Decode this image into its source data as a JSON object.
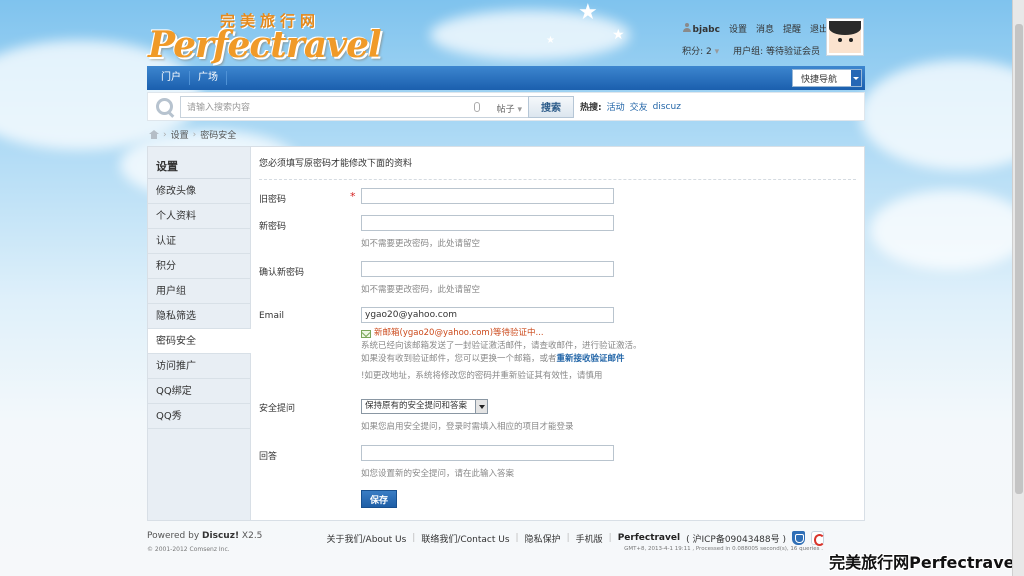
{
  "logo": {
    "cn": "完美旅行网",
    "en": "Perfectravel"
  },
  "user": {
    "name": "bjabc",
    "links": [
      "设置",
      "消息",
      "提醒",
      "退出"
    ],
    "points": "积分: 2",
    "group": "用户组: 等待验证会员"
  },
  "nav": {
    "items": [
      "门户",
      "广场"
    ],
    "quick_nav": "快捷导航"
  },
  "search": {
    "placeholder": "请输入搜索内容",
    "type": "帖子",
    "button": "搜索",
    "hot_label": "热搜:",
    "hot_items": [
      "活动",
      "交友",
      "discuz"
    ]
  },
  "breadcrumb": [
    "设置",
    "密码安全"
  ],
  "sidebar": {
    "title": "设置",
    "items": [
      "修改头像",
      "个人资料",
      "认证",
      "积分",
      "用户组",
      "隐私筛选",
      "密码安全",
      "访问推广",
      "QQ绑定",
      "QQ秀"
    ],
    "active": "密码安全"
  },
  "form": {
    "notice": "您必须填写原密码才能修改下面的资料",
    "old_password_label": "旧密码",
    "required_mark": "*",
    "new_password_label": "新密码",
    "new_password_hint": "如不需要更改密码，此处请留空",
    "confirm_label": "确认新密码",
    "confirm_hint": "如不需要更改密码，此处请留空",
    "email_label": "Email",
    "email_value": "ygao20@yahoo.com",
    "email_pending": "新邮箱(ygao20@yahoo.com)等待验证中...",
    "email_note1": "系统已经向该邮箱发送了一封验证激活邮件，请查收邮件，进行验证激活。",
    "email_note2_prefix": "如果没有收到验证邮件，您可以更换一个邮箱，或者",
    "email_note2_link": "重新接收验证邮件",
    "email_note3": "!如更改地址，系统将修改您的密码并重新验证其有效性，请慎用",
    "security_q_label": "安全提问",
    "security_q_value": "保持原有的安全提问和答案",
    "security_q_hint": "如果您启用安全提问，登录时需填入相应的项目才能登录",
    "answer_label": "回答",
    "answer_hint": "如您设置新的安全提问，请在此输入答案",
    "save_button": "保存"
  },
  "footer": {
    "powered_prefix": "Powered by",
    "powered_brand": "Discuz!",
    "powered_version": "X2.5",
    "copyright": "© 2001-2012 Comsenz Inc.",
    "links": [
      "关于我们/About Us",
      "联络我们/Contact Us",
      "隐私保护",
      "手机版"
    ],
    "brand": "Perfectravel",
    "icp": "( 沪ICP备09043488号 )",
    "stats": "GMT+8, 2013-4-1 19:11 , Processed in 0.088005 second(s), 16 queries ."
  },
  "watermark": "完美旅行网Perfectravel",
  "icons": [
    "search-icon",
    "mic-icon",
    "home-icon",
    "person-icon",
    "mail-icon",
    "shield-icon",
    "cnzz-icon"
  ]
}
